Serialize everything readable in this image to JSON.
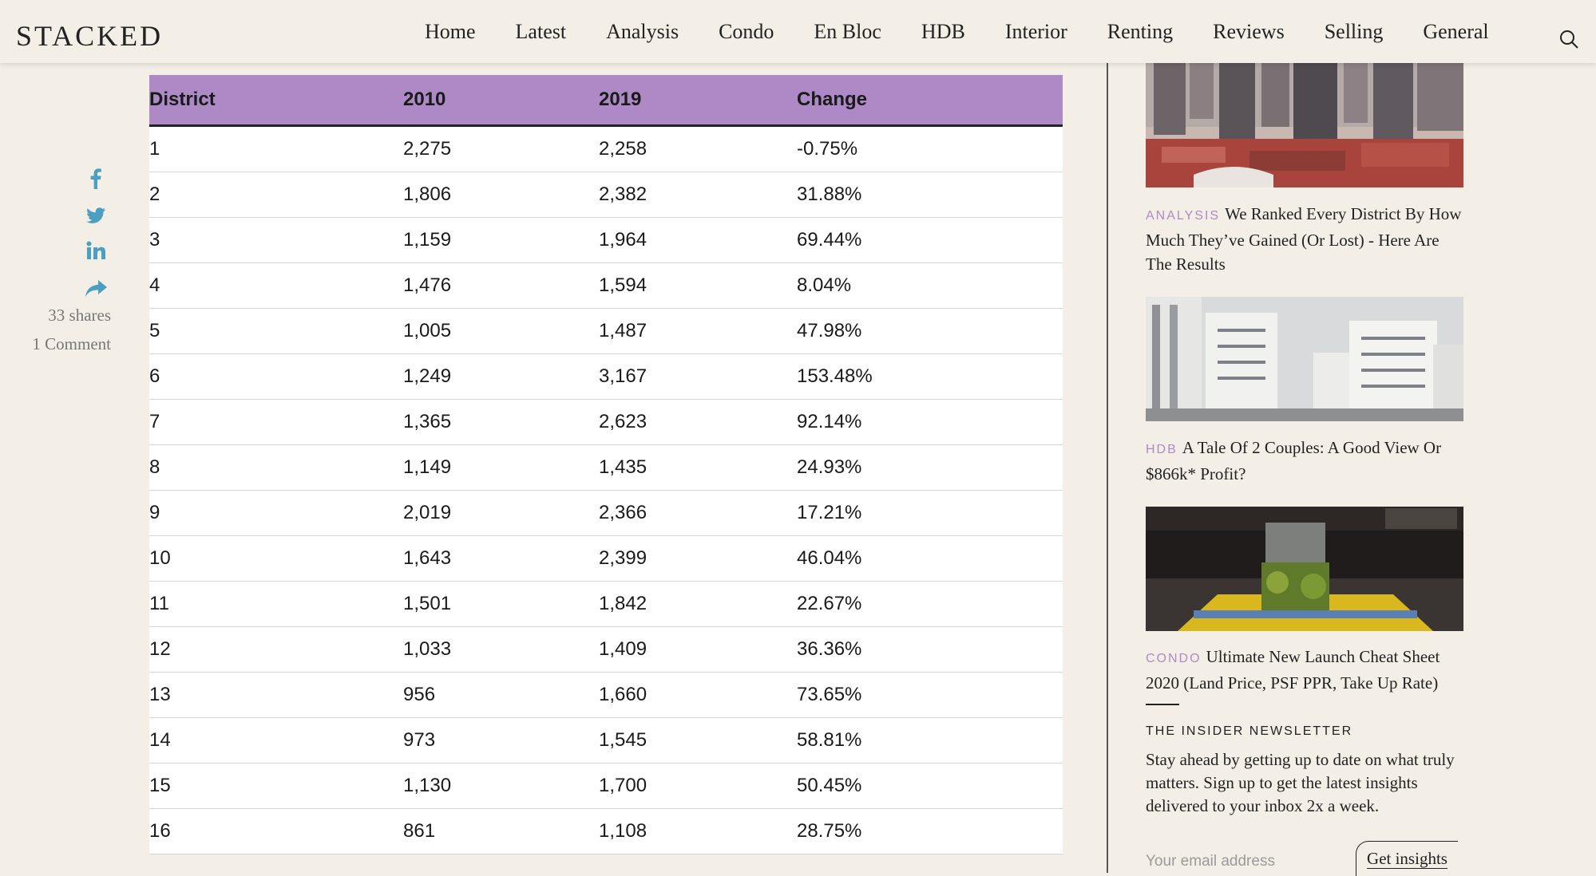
{
  "header": {
    "logo": "STACKED",
    "nav": [
      "Home",
      "Latest",
      "Analysis",
      "Condo",
      "En Bloc",
      "HDB",
      "Interior",
      "Renting",
      "Reviews",
      "Selling",
      "General"
    ],
    "search_icon": "search-icon"
  },
  "share": {
    "icons": [
      "facebook-icon",
      "twitter-icon",
      "linkedin-icon",
      "share-arrow-icon"
    ],
    "icon_color": "#4a9fc2",
    "shares": "33 shares",
    "comments": "1 Comment"
  },
  "table": {
    "header_color": "#ad89c6",
    "columns": [
      "District",
      "2010",
      "2019",
      "Change"
    ],
    "rows": [
      [
        "1",
        "2,275",
        "2,258",
        "-0.75%"
      ],
      [
        "2",
        "1,806",
        "2,382",
        "31.88%"
      ],
      [
        "3",
        "1,159",
        "1,964",
        "69.44%"
      ],
      [
        "4",
        "1,476",
        "1,594",
        "8.04%"
      ],
      [
        "5",
        "1,005",
        "1,487",
        "47.98%"
      ],
      [
        "6",
        "1,249",
        "3,167",
        "153.48%"
      ],
      [
        "7",
        "1,365",
        "2,623",
        "92.14%"
      ],
      [
        "8",
        "1,149",
        "1,435",
        "24.93%"
      ],
      [
        "9",
        "2,019",
        "2,366",
        "17.21%"
      ],
      [
        "10",
        "1,643",
        "2,399",
        "46.04%"
      ],
      [
        "11",
        "1,501",
        "1,842",
        "22.67%"
      ],
      [
        "12",
        "1,033",
        "1,409",
        "36.36%"
      ],
      [
        "13",
        "956",
        "1,660",
        "73.65%"
      ],
      [
        "14",
        "973",
        "1,545",
        "58.81%"
      ],
      [
        "15",
        "1,130",
        "1,700",
        "50.45%"
      ],
      [
        "16",
        "861",
        "1,108",
        "28.75%"
      ]
    ]
  },
  "sidebar": {
    "category_color": "#b08ac4",
    "articles": [
      {
        "category": "ANALYSIS",
        "title": "We Ranked Every District By How Much They’ve Gained (Or Lost) - Here Are The Results"
      },
      {
        "category": "HDB",
        "title": "A Tale Of 2 Couples: A Good View Or $866k* Profit?"
      },
      {
        "category": "CONDO",
        "title": "Ultimate New Launch Cheat Sheet 2020 (Land Price, PSF PPR, Take Up Rate)"
      }
    ],
    "newsletter": {
      "title": "THE INSIDER NEWSLETTER",
      "body": "Stay ahead by getting up to date on what truly matters. Sign up to get the latest insights delivered to your inbox 2x a week.",
      "email_placeholder": "Your email address",
      "button": "Get insights"
    }
  }
}
